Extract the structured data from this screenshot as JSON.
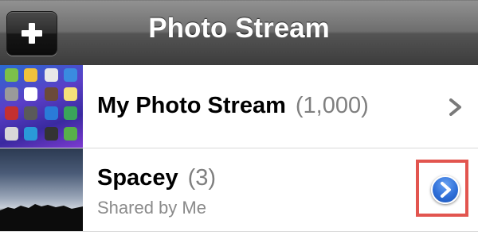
{
  "navbar": {
    "title": "Photo Stream",
    "add_icon": "plus-icon"
  },
  "rows": [
    {
      "title": "My Photo Stream",
      "count": "(1,000)",
      "accessory_icon": "chevron-right-icon"
    },
    {
      "title": "Spacey",
      "count": "(3)",
      "subtitle": "Shared by Me",
      "accessory_icon": "detail-disclosure-icon",
      "highlight_color": "#e2554f"
    }
  ],
  "colors": {
    "navbar_dark": "#3c3c3c",
    "disclosure_blue": "#2f6fd8",
    "count_gray": "#7f7f7f"
  }
}
